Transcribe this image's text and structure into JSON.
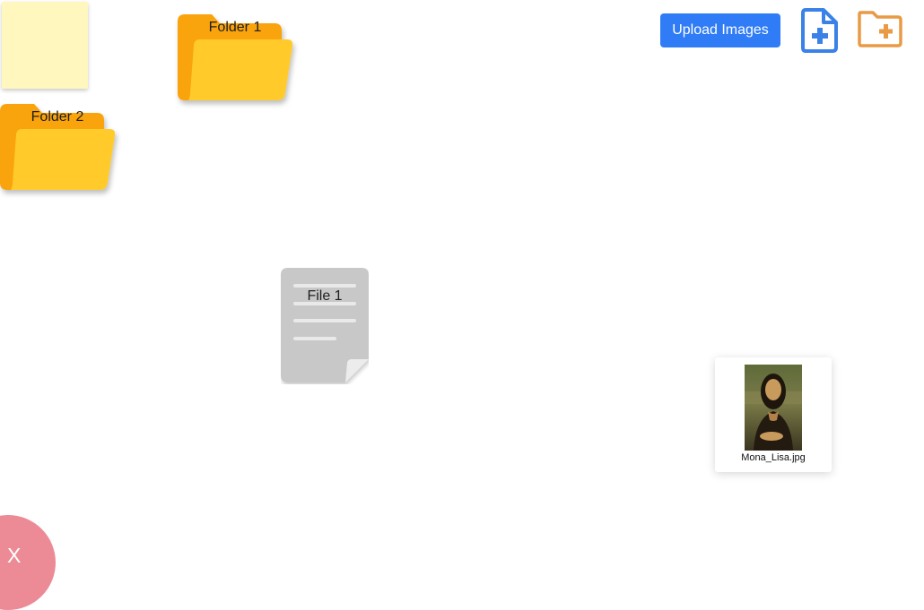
{
  "desktop": {
    "folders": [
      {
        "label": "Folder 1"
      },
      {
        "label": "Folder 2"
      }
    ],
    "files": [
      {
        "label": "File 1"
      }
    ],
    "image": {
      "filename": "Mona_Lisa.jpg"
    }
  },
  "toolbar": {
    "upload_label": "Upload Images",
    "new_file_icon": "file-plus-icon",
    "new_folder_icon": "folder-plus-icon"
  },
  "trash": {
    "label": "X"
  },
  "colors": {
    "note": "#fff7bd",
    "folder_back": "#f9a30a",
    "folder_front": "#ffca2c",
    "file": "#c8c8c8",
    "accent_blue": "#2f7cf6",
    "accent_orange": "#e89a45",
    "trash": "#ec8b95"
  }
}
